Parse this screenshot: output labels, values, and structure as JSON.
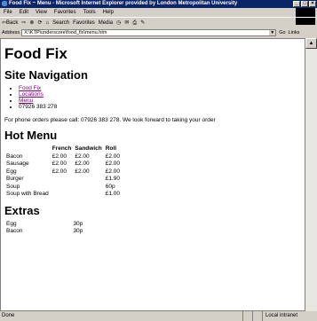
{
  "window": {
    "title": "Food Fix ~ Menu - Microsoft Internet Explorer provided by London Metropolitan University",
    "controls": [
      "_",
      "□",
      "×"
    ]
  },
  "menubar": [
    "File",
    "Edit",
    "View",
    "Favorites",
    "Tools",
    "Help"
  ],
  "toolbar": {
    "back": "⇦Back",
    "forward": "⇨",
    "stop": "⊗",
    "refresh": "⟳",
    "home": "⌂",
    "search": "Search",
    "favorites": "Favorites",
    "media": "Media",
    "history": "◷",
    "mail": "✉",
    "print": "⎙",
    "edit": "✎"
  },
  "address": {
    "label": "Address",
    "value": "X:\\KTP\\underscore\\food_fix\\menu.htm",
    "go": "Go",
    "links": "Links"
  },
  "page": {
    "title": "Food Fix",
    "nav_heading": "Site Navigation",
    "nav_items": [
      "Food Fix",
      "Locations",
      "Menu"
    ],
    "phone": "07926 383 278",
    "phone_text": "For phone orders please call: 07926 383 278. We look forward to taking your order",
    "hot_heading": "Hot Menu",
    "hot_headers": [
      "",
      "French",
      "Sandwich",
      "Roll"
    ],
    "hot_rows": [
      [
        "Bacon",
        "£2.00",
        "£2.00",
        "£2.00"
      ],
      [
        "Sausage",
        "£2.00",
        "£2.00",
        "£2.00"
      ],
      [
        "Egg",
        "£2.00",
        "£2.00",
        "£2.00"
      ],
      [
        "Burger",
        "",
        "",
        "£1.90"
      ],
      [
        "Soup",
        "",
        "",
        "60p"
      ],
      [
        "Soup with Bread",
        "",
        "",
        "£1.00"
      ]
    ],
    "extras_heading": "Extras",
    "extras_rows": [
      [
        "Egg",
        "30p"
      ],
      [
        "Bacon",
        "30p"
      ]
    ]
  },
  "status": {
    "text": "Done",
    "zone": "Local intranet"
  }
}
